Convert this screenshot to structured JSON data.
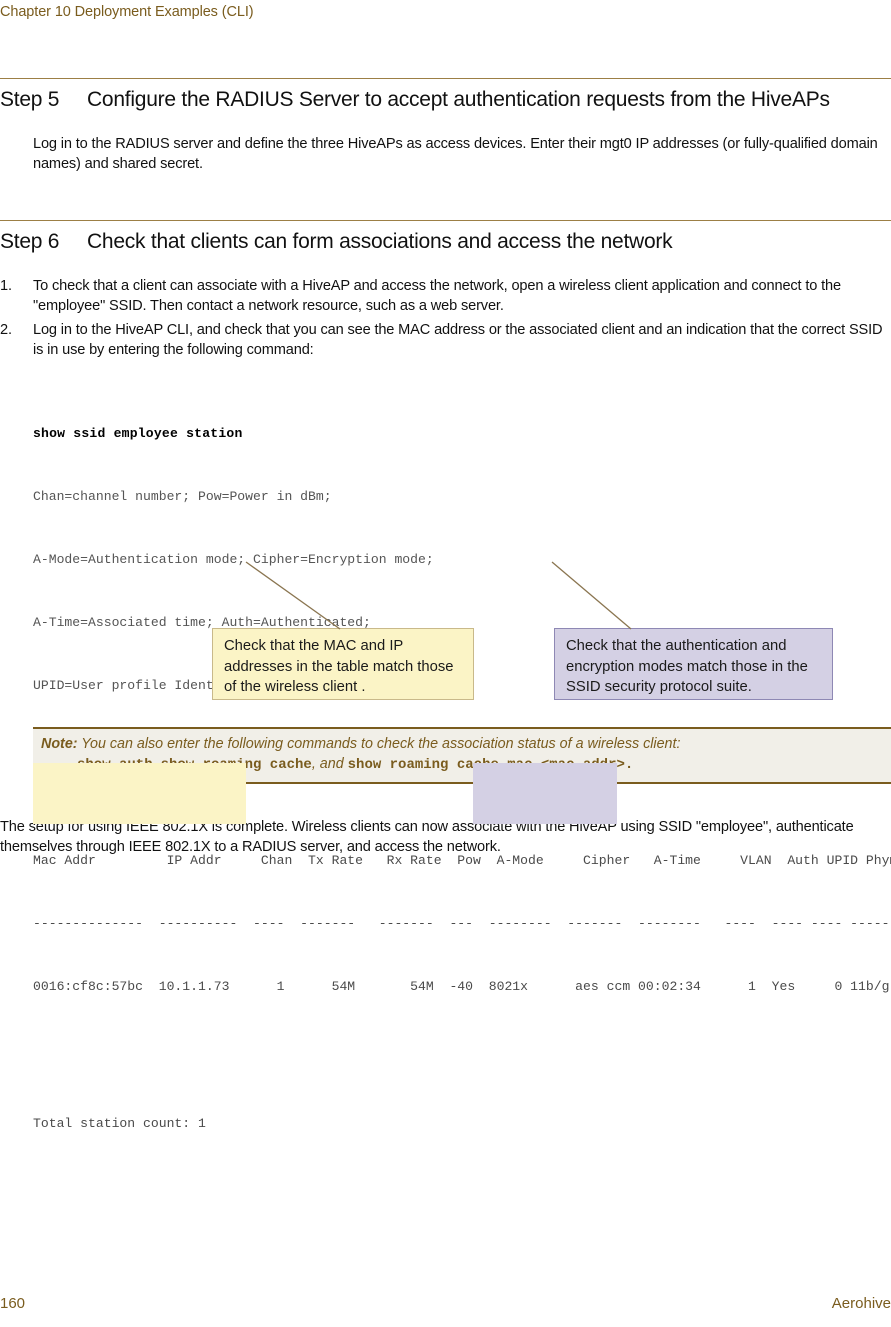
{
  "header": {
    "running_head": "Chapter 10 Deployment Examples (CLI)"
  },
  "steps": [
    {
      "label": "Step 5",
      "title": "Configure the RADIUS Server to accept authentication requests from the HiveAPs",
      "body": "Log in to the RADIUS server and define the three HiveAPs as access devices. Enter their mgt0 IP addresses (or fully-qualified domain names) and shared secret."
    },
    {
      "label": "Step 6",
      "title": "Check that clients can form associations and access the network"
    }
  ],
  "list": {
    "items": [
      {
        "num": "1.",
        "text": "To check that a client can associate with a HiveAP and access the network, open a wireless client application and connect to the \"employee\" SSID. Then contact a network resource, such as a web server."
      },
      {
        "num": "2.",
        "text": "Log in to the HiveAP CLI, and check that you can see the MAC address or the associated client and an indication that the correct SSID is in use by entering the following command:"
      }
    ]
  },
  "cli": {
    "command": "show ssid employee station",
    "legend": [
      "Chan=channel number; Pow=Power in dBm;",
      "A-Mode=Authentication mode; Cipher=Encryption mode;",
      "A-Time=Associated time; Auth=Authenticated;",
      "UPID=User profile Identifier; Phymode=Physical mode;"
    ],
    "table": {
      "header_row": "Mac Addr         IP Addr     Chan  Tx Rate   Rx Rate  Pow  A-Mode     Cipher   A-Time     VLAN  Auth UPID Phymode",
      "divider_row": "--------------  ----------  ----  -------   -------  ---  --------  -------  --------   ----  ---- ---- -------",
      "data_row": "0016:cf8c:57bc  10.1.1.73      1      54M       54M  -40  8021x      aes ccm 00:02:34      1  Yes     0 11b/g",
      "columns": [
        "Mac Addr",
        "IP Addr",
        "Chan",
        "Tx Rate",
        "Rx Rate",
        "Pow",
        "A-Mode",
        "Cipher",
        "A-Time",
        "VLAN",
        "Auth",
        "UPID",
        "Phymode"
      ],
      "values": [
        "0016:cf8c:57bc",
        "10.1.1.73",
        "1",
        "54M",
        "54M",
        "-40",
        "8021x",
        "aes ccm",
        "00:02:34",
        "1",
        "Yes",
        "0",
        "11b/g"
      ]
    },
    "total": "Total station count: 1"
  },
  "callouts": [
    {
      "text": "Check that the MAC and IP addresses in the table match those of the wireless client .",
      "bg": "#FBF4C6",
      "border": "#C9B98A"
    },
    {
      "text": "Check that the authentication and encryption modes match those in the SSID security protocol suite.",
      "bg": "#D4D0E4",
      "border": "#8E88B4"
    }
  ],
  "note": {
    "label": "Note:",
    "line1": "You can also enter the following commands to check the association status of a wireless client:",
    "cmd1": "show auth",
    "sep1": ",",
    "cmd2": "show roaming cache",
    "sep2": ",",
    "conjunction": "and",
    "cmd3": "show roaming cache mac <mac_addr>",
    "end": "."
  },
  "closing": {
    "paragraph": "The setup for using IEEE 802.1X is complete. Wireless clients can now associate with the HiveAP using SSID \"employee\", authenticate themselves through IEEE 802.1X to a RADIUS server, and access the network."
  },
  "footer": {
    "page_number": "160",
    "brand": "Aerohive"
  },
  "colors": {
    "accent_brown": "#7A5C1E",
    "rule_brown": "#9C7F45",
    "highlight_yellow": "#FBF4C6",
    "highlight_purple": "#D4D0E4",
    "note_bg": "#F1EFE8"
  }
}
